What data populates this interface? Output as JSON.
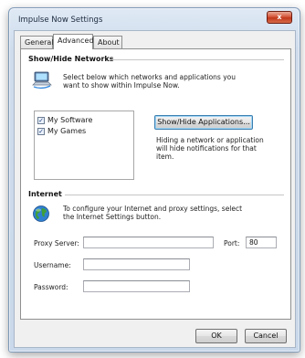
{
  "window": {
    "title": "Impulse Now Settings",
    "close_glyph": "x"
  },
  "tabs": [
    {
      "label": "General"
    },
    {
      "label": "Advanced"
    },
    {
      "label": "About"
    }
  ],
  "networks": {
    "heading": "Show/Hide Networks",
    "description_line1": "Select below which networks and applications you",
    "description_line2": "want to show within Impulse Now.",
    "icon": "network-computer-icon",
    "items": [
      {
        "label": "My Software",
        "checked": true
      },
      {
        "label": "My Games",
        "checked": true
      }
    ],
    "button_label": "Show/Hide Applications...",
    "hint_line1": "Hiding a network or application",
    "hint_line2": "will hide notifications for that",
    "hint_line3": "item."
  },
  "internet": {
    "heading": "Internet",
    "icon": "globe-icon",
    "description_line1": "To configure your Internet and proxy settings, select",
    "description_line2": "the Internet Settings button.",
    "proxy_label": "Proxy Server:",
    "proxy_value": "",
    "port_label": "Port:",
    "port_value": "80",
    "username_label": "Username:",
    "username_value": "",
    "password_label": "Password:",
    "password_value": ""
  },
  "footer": {
    "ok_label": "OK",
    "cancel_label": "Cancel"
  },
  "colors": {
    "accent": "#3c7fb1",
    "close_button": "#c2391c",
    "frame": "#c9d8ea"
  }
}
